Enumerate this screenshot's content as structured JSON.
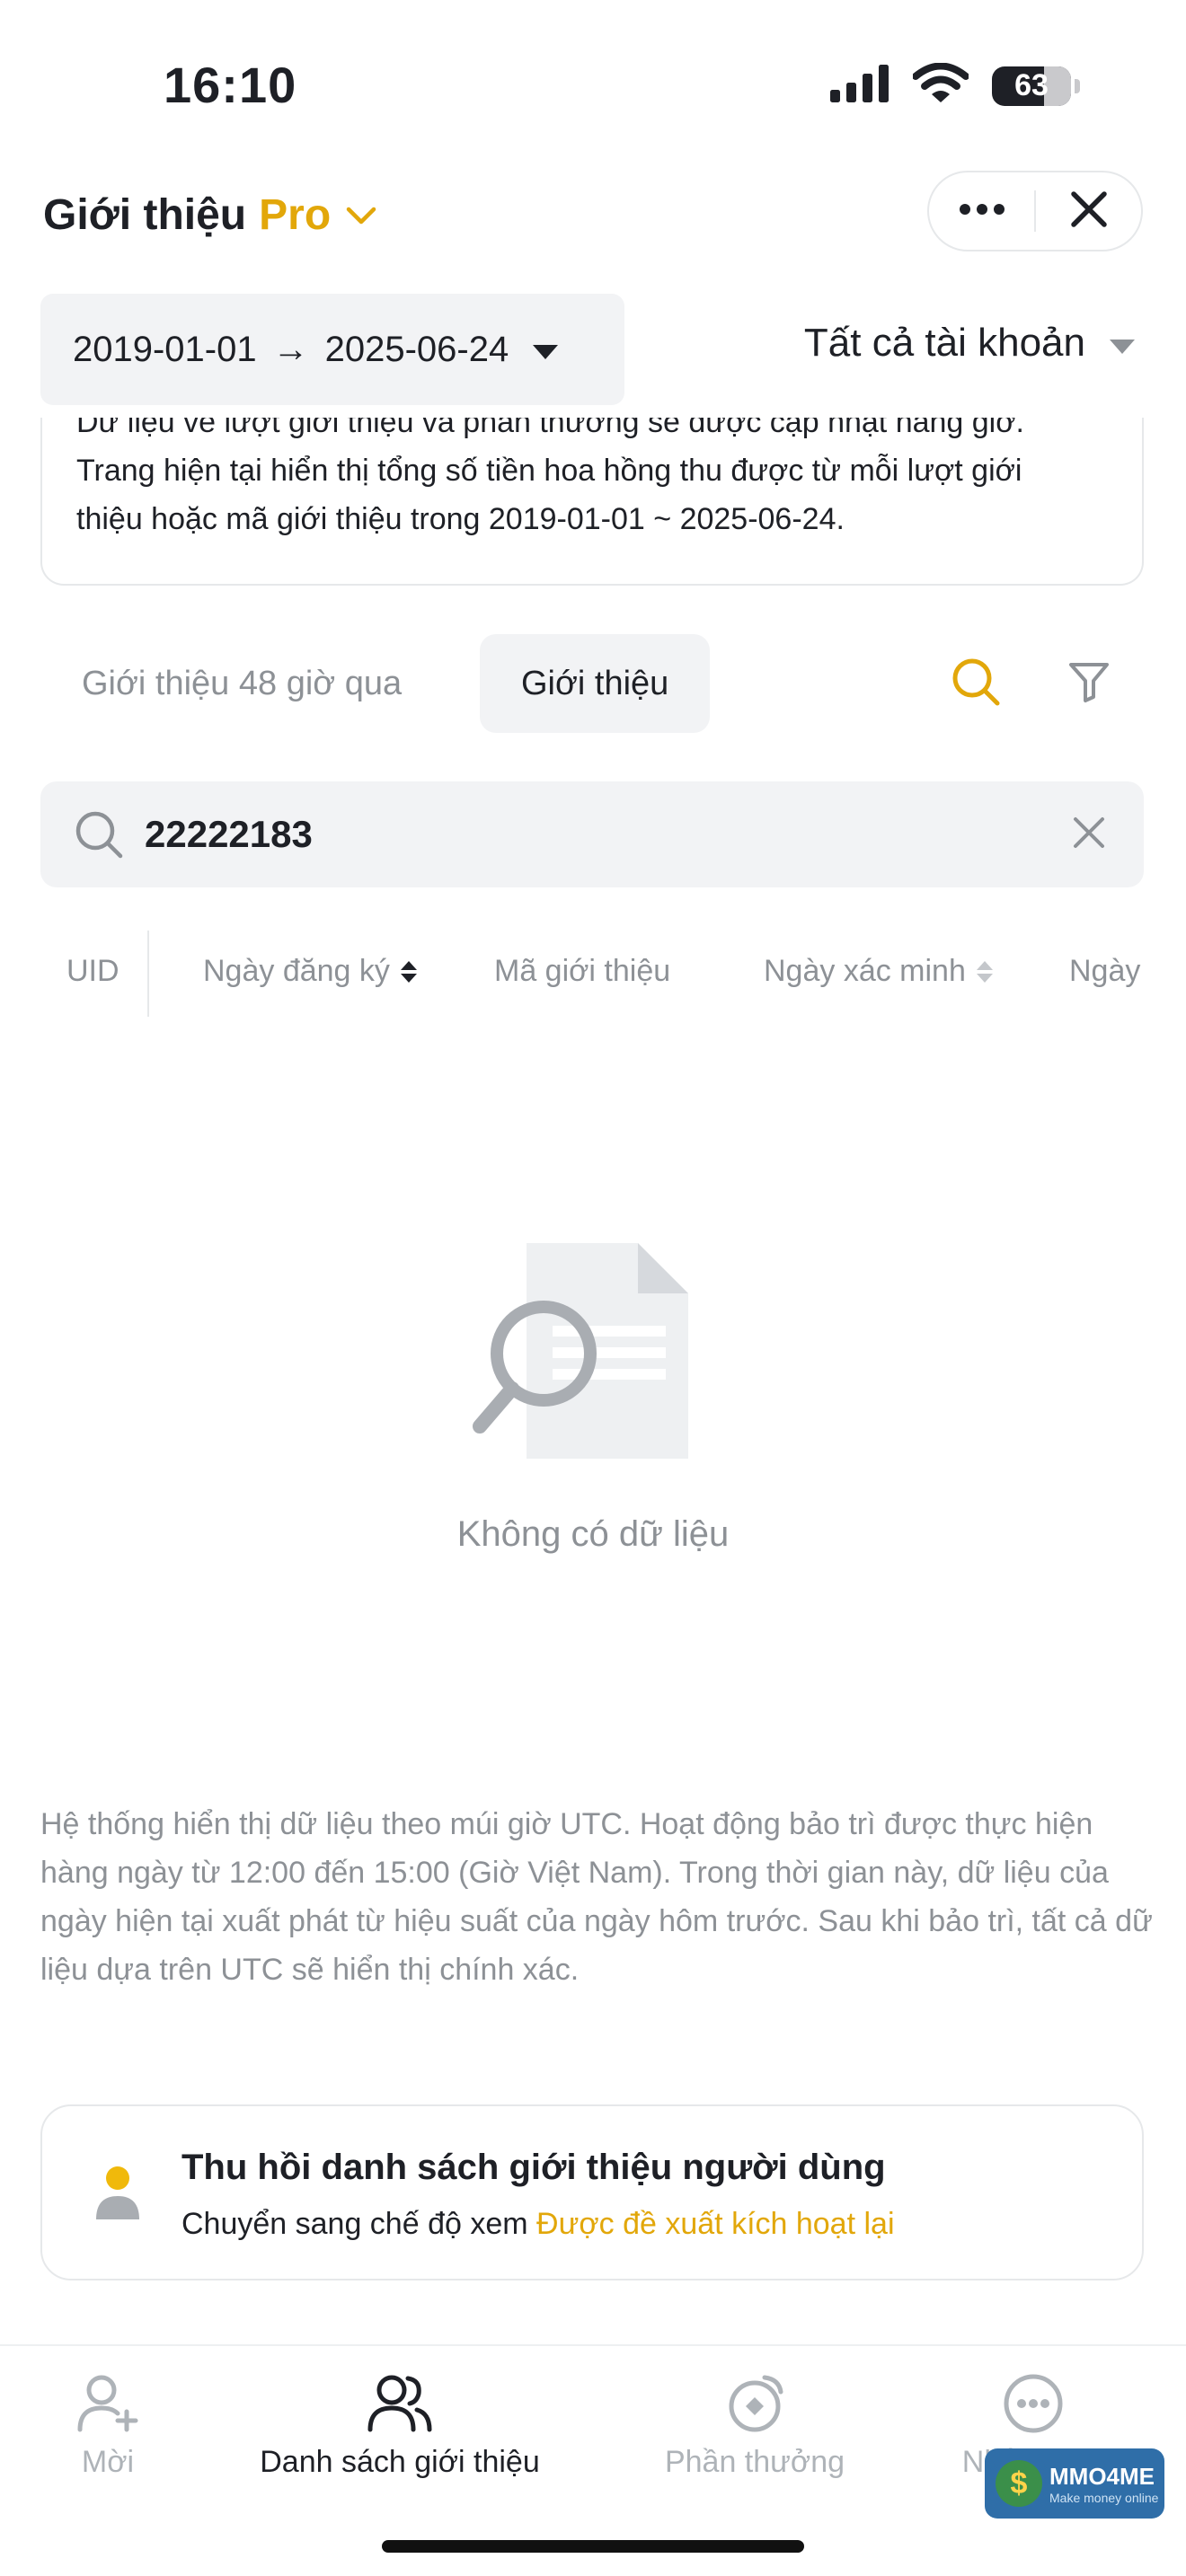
{
  "status_bar": {
    "time": "16:10",
    "battery": "63",
    "icons": [
      "cellular-signal-icon",
      "wifi-icon",
      "battery-icon"
    ]
  },
  "header": {
    "title": "Giới thiệu",
    "title_accent": "Pro",
    "icons": [
      "chevron-down-icon",
      "more-icon",
      "close-icon"
    ]
  },
  "filters": {
    "date_start": "2019-01-01",
    "date_arrow": "→",
    "date_end": "2025-06-24",
    "account_label": "Tất cả tài khoản"
  },
  "notice": {
    "line1": "Dữ liệu về lượt giới thiệu và phần thưởng sẽ được cập nhật hàng giờ.",
    "line2": "Trang hiện tại hiển thị tổng số tiền hoa hồng thu được từ mỗi lượt giới",
    "line3": "thiệu hoặc mã giới thiệu trong 2019-01-01 ~ 2025-06-24."
  },
  "tabs": {
    "items": [
      {
        "label": "Giới thiệu 48 giờ qua",
        "active": false
      },
      {
        "label": "Giới thiệu",
        "active": true
      }
    ]
  },
  "search": {
    "value": "22222183"
  },
  "table": {
    "columns": [
      "UID",
      "Ngày đăng ký",
      "Mã giới thiệu",
      "Ngày xác minh",
      "Ngày"
    ]
  },
  "empty_state": {
    "text": "Không có dữ liệu"
  },
  "disclaimer": {
    "text": "Hệ thống hiển thị dữ liệu theo múi giờ UTC. Hoạt động bảo trì được thực hiện hàng ngày từ 12:00 đến 15:00 (Giờ Việt Nam). Trong thời gian này, dữ liệu của ngày hiện tại xuất phát từ hiệu suất của ngày hôm trước. Sau khi bảo trì, tất cả dữ liệu dựa trên UTC sẽ hiển thị chính xác."
  },
  "recall_card": {
    "title": "Thu hồi danh sách giới thiệu người dùng",
    "subtitle_prefix": "Chuyển sang chế độ xem ",
    "subtitle_link": "Được đề xuất kích hoạt lại"
  },
  "bottom_nav": {
    "items": [
      {
        "label": "Mời",
        "icon": "add-user-icon",
        "active": false
      },
      {
        "label": "Danh sách giới thiệu",
        "icon": "users-icon",
        "active": true
      },
      {
        "label": "Phần thưởng",
        "icon": "rewards-icon",
        "active": false
      },
      {
        "label": "Nhiều hơn",
        "icon": "more-circle-icon",
        "active": false
      }
    ]
  },
  "watermark": {
    "coin": "$",
    "brand": "MMO4ME",
    "tagline": "Make money online"
  },
  "colors": {
    "accent": "#e2a70a",
    "text": "#1e2026",
    "muted": "#8d9196",
    "surface": "#f2f3f5"
  }
}
